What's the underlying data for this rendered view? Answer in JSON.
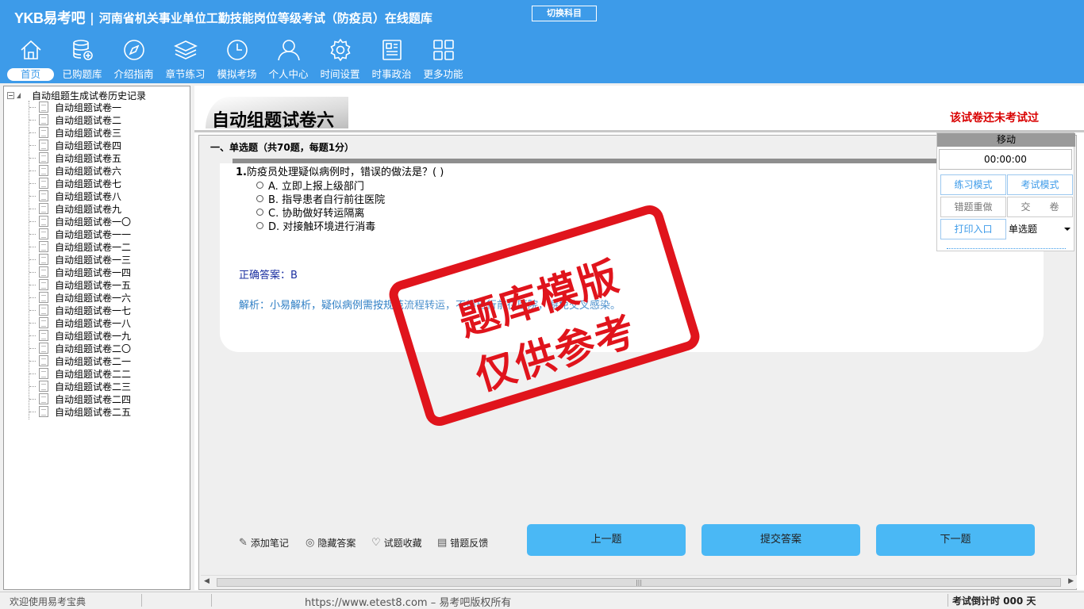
{
  "header": {
    "logo": "YKB易考吧",
    "title": "河南省机关事业单位工勤技能岗位等级考试（防疫员）在线题库",
    "switch_label": "切换科目"
  },
  "nav": [
    {
      "label": "首页",
      "icon": "home-icon"
    },
    {
      "label": "已购题库",
      "icon": "database-icon"
    },
    {
      "label": "介绍指南",
      "icon": "compass-icon"
    },
    {
      "label": "章节练习",
      "icon": "layers-icon"
    },
    {
      "label": "模拟考场",
      "icon": "clock-icon"
    },
    {
      "label": "个人中心",
      "icon": "user-icon"
    },
    {
      "label": "时间设置",
      "icon": "gear-icon"
    },
    {
      "label": "时事政治",
      "icon": "news-icon"
    },
    {
      "label": "更多功能",
      "icon": "grid-icon"
    }
  ],
  "tree": {
    "root": "自动组题生成试卷历史记录",
    "items": [
      "自动组题试卷一",
      "自动组题试卷二",
      "自动组题试卷三",
      "自动组题试卷四",
      "自动组题试卷五",
      "自动组题试卷六",
      "自动组题试卷七",
      "自动组题试卷八",
      "自动组题试卷九",
      "自动组题试卷一〇",
      "自动组题试卷一一",
      "自动组题试卷一二",
      "自动组题试卷一三",
      "自动组题试卷一四",
      "自动组题试卷一五",
      "自动组题试卷一六",
      "自动组题试卷一七",
      "自动组题试卷一八",
      "自动组题试卷一九",
      "自动组题试卷二〇",
      "自动组题试卷二一",
      "自动组题试卷二二",
      "自动组题试卷二三",
      "自动组题试卷二四",
      "自动组题试卷二五"
    ]
  },
  "main": {
    "paper_title": "自动组题试卷六",
    "status": "该试卷还未考试过",
    "section": "一、单选题（共70题，每题1分）",
    "question": {
      "number": "1.",
      "text": "防疫员处理疑似病例时，错误的做法是？( )",
      "options": [
        "A. 立即上报上级部门",
        "B. 指导患者自行前往医院",
        "C. 协助做好转运隔离",
        "D. 对接触环境进行消毒"
      ],
      "answer": "正确答案：B",
      "analysis": "解析：小易解析，疑似病例需按规范流程转运，不得自行前往医院，避免交叉感染。"
    },
    "stamp": {
      "line1": "题库模版",
      "line2": "仅供参考"
    },
    "tools": [
      {
        "label": "添加笔记",
        "icon": "pencil-icon"
      },
      {
        "label": "隐藏答案",
        "icon": "eye-icon"
      },
      {
        "label": "试题收藏",
        "icon": "heart-icon"
      },
      {
        "label": "错题反馈",
        "icon": "feedback-icon"
      }
    ],
    "buttons": {
      "prev": "上一题",
      "submit": "提交答案",
      "next": "下一题"
    }
  },
  "float_panel": {
    "title": "移动",
    "timer": "00:00:00",
    "practice_mode": "练习模式",
    "exam_mode": "考试模式",
    "redo_wrong": "错题重做",
    "submit_paper": "交　　卷",
    "print_entry": "打印入口",
    "type_select": "单选题"
  },
  "statusbar": {
    "welcome": "欢迎使用易考宝典",
    "copyright": "https://www.etest8.com – 易考吧版权所有",
    "countdown": "考试倒计时 000 天"
  }
}
